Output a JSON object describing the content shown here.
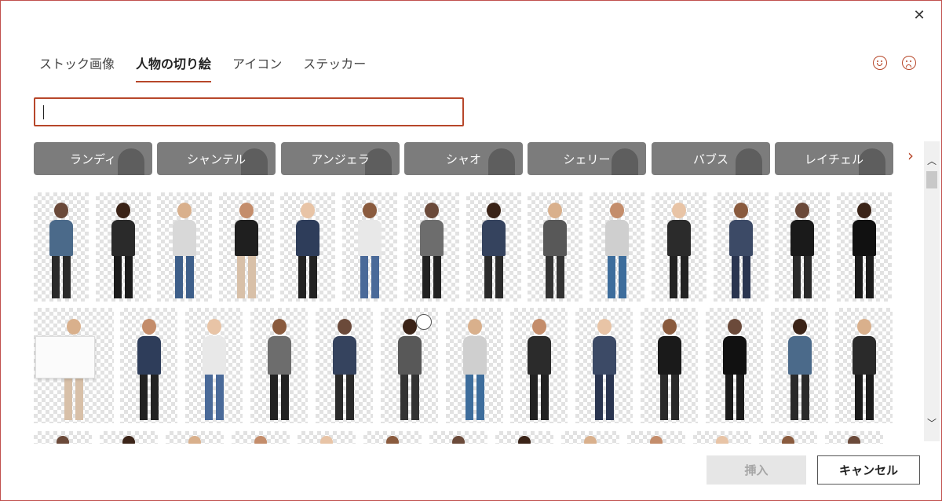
{
  "dialog": {
    "close_icon": "close-icon",
    "close_glyph": "✕"
  },
  "tabs": [
    {
      "label": "ストック画像",
      "active": false
    },
    {
      "label": "人物の切り絵",
      "active": true
    },
    {
      "label": "アイコン",
      "active": false
    },
    {
      "label": "ステッカー",
      "active": false
    }
  ],
  "feedback": {
    "smile_icon": "smile-icon",
    "frown_icon": "frown-icon"
  },
  "search": {
    "value": "",
    "placeholder": ""
  },
  "people_filters": [
    {
      "label": "ランディ"
    },
    {
      "label": "シャンテル"
    },
    {
      "label": "アンジェラ"
    },
    {
      "label": "シャオ"
    },
    {
      "label": "シェリー"
    },
    {
      "label": "バブス"
    },
    {
      "label": "レイチェル"
    }
  ],
  "filters_next_glyph": "›",
  "scrollbar": {
    "up_glyph": "︿",
    "down_glyph": "﹀"
  },
  "buttons": {
    "insert": "挿入",
    "cancel": "キャンセル"
  },
  "colors": {
    "accent": "#b7472a",
    "chip_bg": "#7c7c7c",
    "disabled_bg": "#e6e6e6"
  }
}
